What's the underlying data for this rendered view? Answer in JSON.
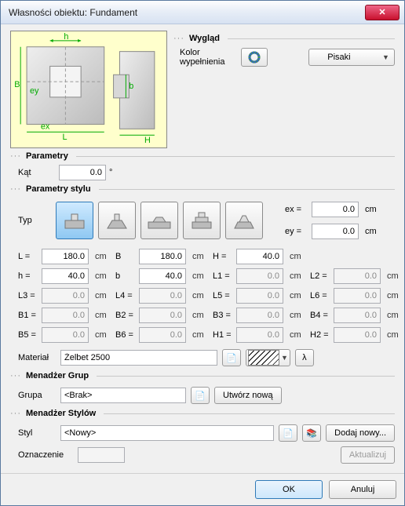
{
  "window": {
    "title": "Własności obiektu: Fundament"
  },
  "appearance": {
    "section": "Wygląd",
    "fill_label": "Kolor\nwypełnienia",
    "pens_label": "Pisaki"
  },
  "sections": {
    "parameters": "Parametry",
    "style_params": "Parametry stylu",
    "group_mgr": "Menadżer Grup",
    "style_mgr": "Menadżer Stylów"
  },
  "angle": {
    "label": "Kąt",
    "value": "0.0",
    "unit": "°"
  },
  "typ_label": "Typ",
  "exey": {
    "ex_label": "ex  =",
    "ex_value": "0.0",
    "unit": "cm",
    "ey_label": "ey  =",
    "ey_value": "0.0"
  },
  "params": [
    {
      "l": "L =",
      "v": "180.0",
      "u": "cm",
      "ro": false
    },
    {
      "l": "B",
      "v": "180.0",
      "u": "cm",
      "ro": false
    },
    {
      "l": "H =",
      "v": "40.0",
      "u": "cm",
      "ro": false
    },
    {
      "l": "",
      "v": "",
      "u": "",
      "ro": false,
      "blank": true
    },
    {
      "l": "h =",
      "v": "40.0",
      "u": "cm",
      "ro": false
    },
    {
      "l": "b",
      "v": "40.0",
      "u": "cm",
      "ro": false
    },
    {
      "l": "L1 =",
      "v": "0.0",
      "u": "cm",
      "ro": true
    },
    {
      "l": "L2 =",
      "v": "0.0",
      "u": "cm",
      "ro": true
    },
    {
      "l": "L3 =",
      "v": "0.0",
      "u": "cm",
      "ro": true
    },
    {
      "l": "L4 =",
      "v": "0.0",
      "u": "cm",
      "ro": true
    },
    {
      "l": "L5 =",
      "v": "0.0",
      "u": "cm",
      "ro": true
    },
    {
      "l": "L6 =",
      "v": "0.0",
      "u": "cm",
      "ro": true
    },
    {
      "l": "B1 =",
      "v": "0.0",
      "u": "cm",
      "ro": true
    },
    {
      "l": "B2 =",
      "v": "0.0",
      "u": "cm",
      "ro": true
    },
    {
      "l": "B3 =",
      "v": "0.0",
      "u": "cm",
      "ro": true
    },
    {
      "l": "B4 =",
      "v": "0.0",
      "u": "cm",
      "ro": true
    },
    {
      "l": "B5 =",
      "v": "0.0",
      "u": "cm",
      "ro": true
    },
    {
      "l": "B6 =",
      "v": "0.0",
      "u": "cm",
      "ro": true
    },
    {
      "l": "H1 =",
      "v": "0.0",
      "u": "cm",
      "ro": true
    },
    {
      "l": "H2 =",
      "v": "0.0",
      "u": "cm",
      "ro": true
    }
  ],
  "material": {
    "label": "Materiał",
    "value": "Żelbet 2500"
  },
  "group": {
    "label": "Grupa",
    "value": "<Brak>",
    "create_label": "Utwórz nową"
  },
  "style": {
    "label": "Styl",
    "value": "<Nowy>",
    "add_label": "Dodaj nowy...",
    "update_label": "Aktualizuj"
  },
  "mark": {
    "label": "Oznaczenie",
    "value": ""
  },
  "buttons": {
    "ok": "OK",
    "cancel": "Anuluj"
  }
}
